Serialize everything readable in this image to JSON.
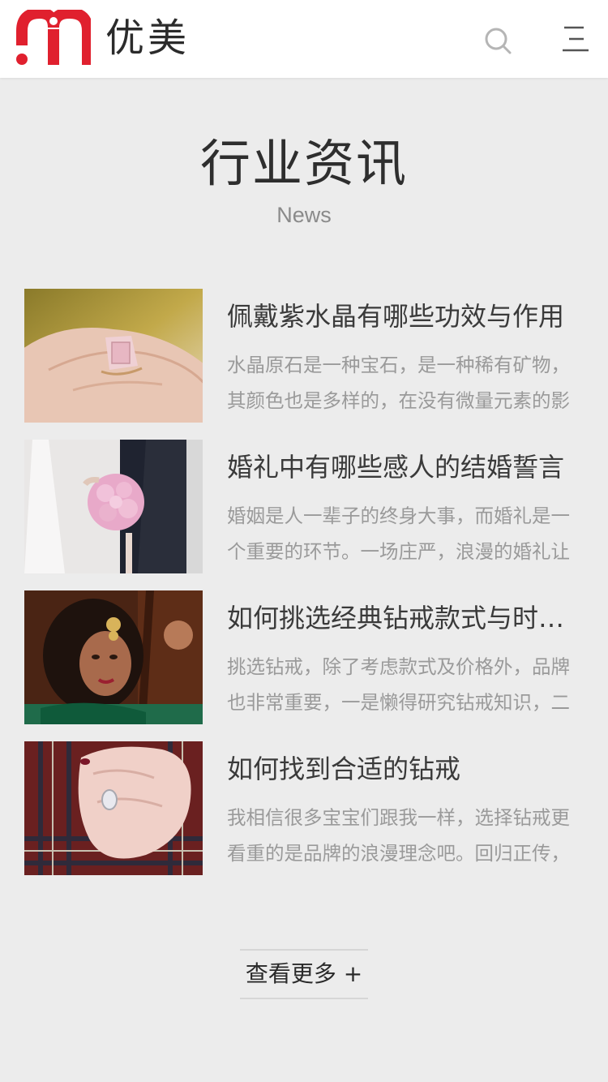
{
  "header": {
    "brand": "优美",
    "logo_color": "#e0202e",
    "icons": [
      "search-icon",
      "menu-icon"
    ]
  },
  "section": {
    "title": "行业资讯",
    "subtitle": "News"
  },
  "news": [
    {
      "title": "佩戴紫水晶有哪些功效与作用",
      "desc": "水晶原石是一种宝石，是一种稀有矿物，其颜色也是多样的，在没有微量元素的影",
      "image": "ring-on-hand-photo"
    },
    {
      "title": "婚礼中有哪些感人的结婚誓言",
      "desc": "婚姻是人一辈子的终身大事，而婚礼是一个重要的环节。一场庄严，浪漫的婚礼让",
      "image": "bride-bouquet-photo"
    },
    {
      "title": "如何挑选经典钻戒款式与时尚钻戒",
      "desc": "挑选钻戒，除了考虑款式及价格外，品牌也非常重要，一是懒得研究钻戒知识，二",
      "image": "bride-portrait-photo"
    },
    {
      "title": "如何找到合适的钻戒",
      "desc": "我相信很多宝宝们跟我一样，选择钻戒更看重的是品牌的浪漫理念吧。回归正传，",
      "image": "diamond-ring-hand-photo"
    }
  ],
  "more_button": {
    "label": "查看更多 +"
  }
}
